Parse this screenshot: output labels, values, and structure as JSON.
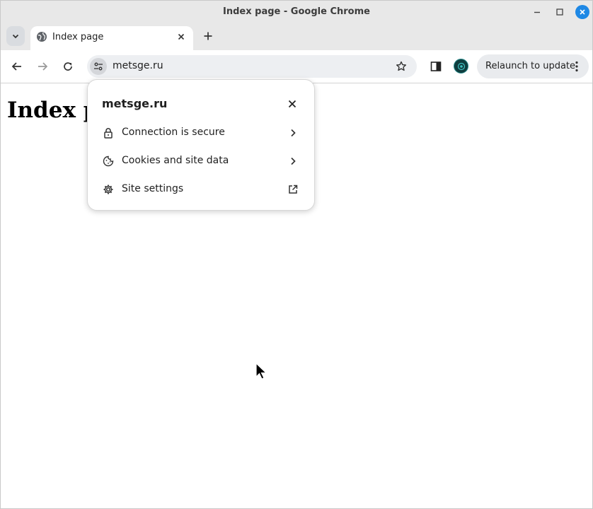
{
  "window": {
    "title": "Index page - Google Chrome"
  },
  "tabs": [
    {
      "title": "Index page",
      "icon": "globe-icon"
    }
  ],
  "omnibox": {
    "url": "metsge.ru"
  },
  "toolbar": {
    "relaunch_label": "Relaunch to update"
  },
  "page": {
    "heading": "Index page"
  },
  "site_info_popup": {
    "title": "metsge.ru",
    "rows": [
      {
        "label": "Connection is secure",
        "icon": "lock-icon",
        "trail": "chevron-right-icon"
      },
      {
        "label": "Cookies and site data",
        "icon": "cookie-icon",
        "trail": "chevron-right-icon"
      },
      {
        "label": "Site settings",
        "icon": "gear-icon",
        "trail": "external-link-icon"
      }
    ]
  },
  "colors": {
    "accent": "#1e88e5",
    "chrome_frame": "#e8e8e8",
    "omnibox_bg": "#edeff2"
  }
}
